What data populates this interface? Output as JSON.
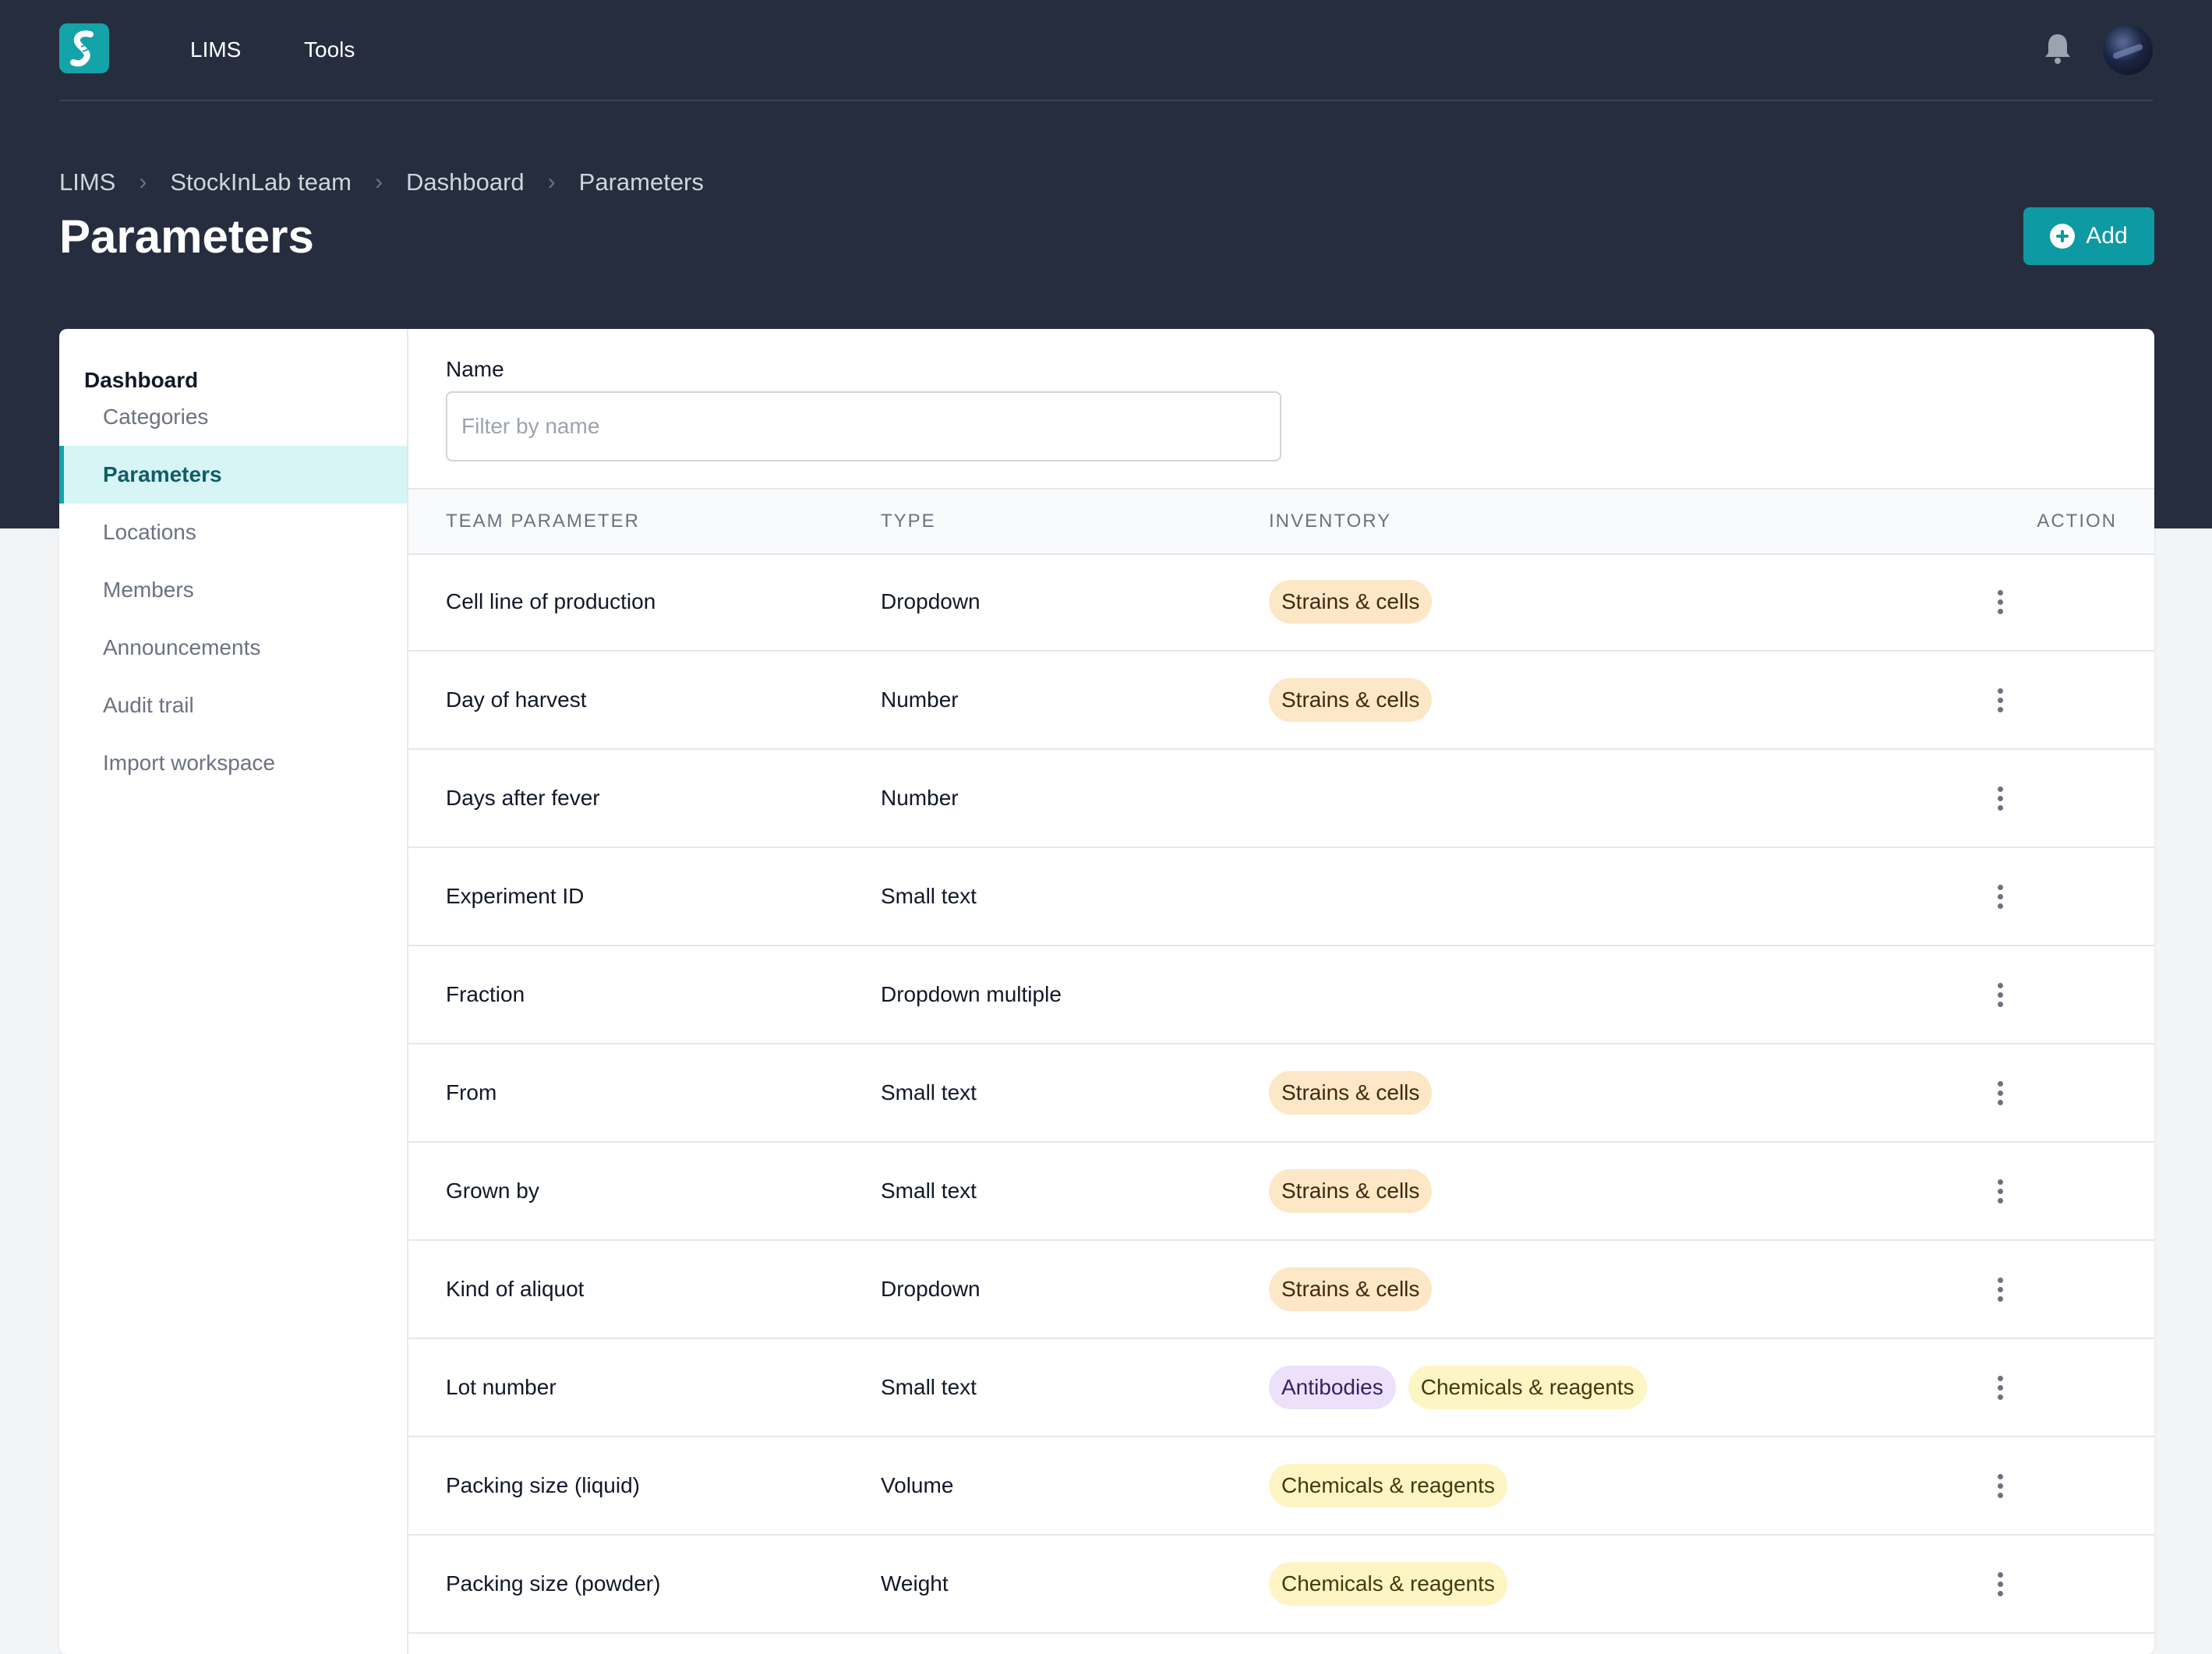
{
  "topnav": {
    "tabs": [
      {
        "label": "LIMS",
        "active": true
      },
      {
        "label": "Tools",
        "active": false
      }
    ],
    "icons": {
      "logo": "stockinlab-logo",
      "notifications": "bell-icon",
      "avatar": "user-avatar"
    }
  },
  "breadcrumb": [
    "LIMS",
    "StockInLab team",
    "Dashboard",
    "Parameters"
  ],
  "page": {
    "title": "Parameters",
    "add_label": "Add"
  },
  "sidebar": {
    "title": "Dashboard",
    "items": [
      {
        "label": "Categories",
        "active": false
      },
      {
        "label": "Parameters",
        "active": true
      },
      {
        "label": "Locations",
        "active": false
      },
      {
        "label": "Members",
        "active": false
      },
      {
        "label": "Announcements",
        "active": false
      },
      {
        "label": "Audit trail",
        "active": false
      },
      {
        "label": "Import workspace",
        "active": false
      }
    ]
  },
  "filter": {
    "label": "Name",
    "placeholder": "Filter by name",
    "value": ""
  },
  "table": {
    "columns": [
      "TEAM PARAMETER",
      "TYPE",
      "INVENTORY",
      "ACTION"
    ],
    "rows": [
      {
        "name": "Cell line of production",
        "type": "Dropdown",
        "inventory": [
          {
            "label": "Strains & cells",
            "color": "orange"
          }
        ]
      },
      {
        "name": "Day of harvest",
        "type": "Number",
        "inventory": [
          {
            "label": "Strains & cells",
            "color": "orange"
          }
        ]
      },
      {
        "name": "Days after fever",
        "type": "Number",
        "inventory": []
      },
      {
        "name": "Experiment ID",
        "type": "Small text",
        "inventory": []
      },
      {
        "name": "Fraction",
        "type": "Dropdown multiple",
        "inventory": []
      },
      {
        "name": "From",
        "type": "Small text",
        "inventory": [
          {
            "label": "Strains & cells",
            "color": "orange"
          }
        ]
      },
      {
        "name": "Grown by",
        "type": "Small text",
        "inventory": [
          {
            "label": "Strains & cells",
            "color": "orange"
          }
        ]
      },
      {
        "name": "Kind of aliquot",
        "type": "Dropdown",
        "inventory": [
          {
            "label": "Strains & cells",
            "color": "orange"
          }
        ]
      },
      {
        "name": "Lot number",
        "type": "Small text",
        "inventory": [
          {
            "label": "Antibodies",
            "color": "purple"
          },
          {
            "label": "Chemicals & reagents",
            "color": "yellow"
          }
        ]
      },
      {
        "name": "Packing size (liquid)",
        "type": "Volume",
        "inventory": [
          {
            "label": "Chemicals & reagents",
            "color": "yellow"
          }
        ]
      },
      {
        "name": "Packing size (powder)",
        "type": "Weight",
        "inventory": [
          {
            "label": "Chemicals & reagents",
            "color": "yellow"
          }
        ]
      }
    ]
  },
  "colors": {
    "header_bg": "#252d3f",
    "accent": "#0e9aa3",
    "chip_orange": "#fde7c7",
    "chip_purple": "#ece0fb",
    "chip_yellow": "#fef5c4"
  }
}
